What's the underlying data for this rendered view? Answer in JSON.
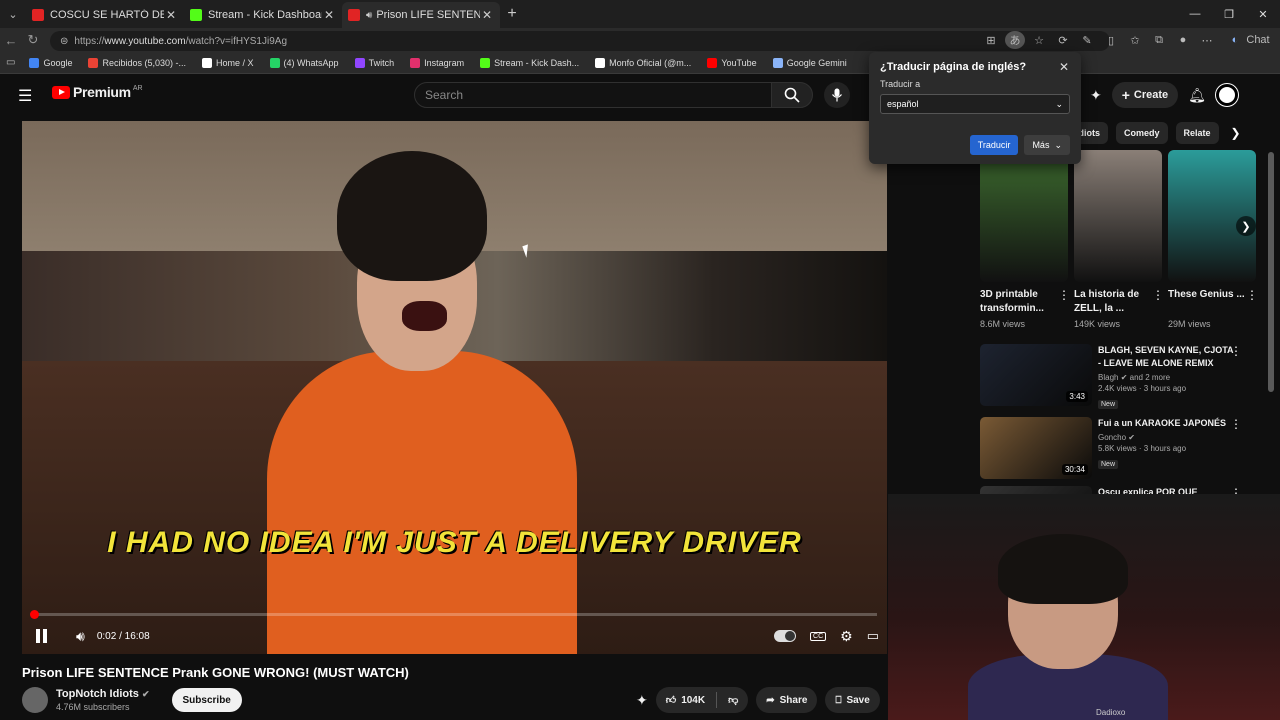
{
  "browser": {
    "tabs": [
      {
        "title": "COSCU SE HARTÓ DE BAULO Y LE",
        "color": "#e12424"
      },
      {
        "title": "Stream - Kick Dashboard",
        "color": "#53fc18"
      },
      {
        "title": "Prison LIFE SENTENCE Prank G",
        "color": "#e12424"
      }
    ],
    "url_prefix": "https://",
    "url_host": "www.youtube.com",
    "url_path": "/watch?v=ifHYS1Ji9Ag",
    "chat_label": "Chat",
    "bookmarks": [
      {
        "label": "Google",
        "color": "#4285f4"
      },
      {
        "label": "Recibidos (5,030) -...",
        "color": "#ea4335"
      },
      {
        "label": "Home / X",
        "color": "#ffffff"
      },
      {
        "label": "(4) WhatsApp",
        "color": "#25d366"
      },
      {
        "label": "Twitch",
        "color": "#9146ff"
      },
      {
        "label": "Instagram",
        "color": "#e1306c"
      },
      {
        "label": "Stream - Kick Dash...",
        "color": "#53fc18"
      },
      {
        "label": "Monfo Oficial (@m...",
        "color": "#ffffff"
      },
      {
        "label": "YouTube",
        "color": "#ff0000"
      },
      {
        "label": "Google Gemini",
        "color": "#8ab4f8"
      }
    ]
  },
  "translate_popup": {
    "title": "¿Traducir página de inglés?",
    "label": "Traducir a",
    "selected_language": "español",
    "translate_button": "Traducir",
    "more_button": "Más"
  },
  "youtube": {
    "brand": "Premium",
    "country": "AR",
    "search_placeholder": "Search",
    "create_label": "Create",
    "video": {
      "subtitle": "I HAD NO IDEA I'M JUST A DELIVERY DRIVER",
      "time": "0:02 / 16:08",
      "progress": 0.002,
      "title": "Prison LIFE SENTENCE Prank GONE WRONG! (MUST WATCH)",
      "channel": "TopNotch Idiots",
      "subscribers": "4.76M subscribers",
      "subscribe_label": "Subscribe",
      "likes": "104K",
      "share_label": "Share",
      "save_label": "Save"
    },
    "chips": [
      "n Idiots",
      "Comedy",
      "Relate"
    ],
    "shorts": [
      {
        "title": "3D printable transformin...",
        "views": "8.6M views",
        "color": "#3d6b2f"
      },
      {
        "title": "La historia de ZELL, la ...",
        "views": "149K views",
        "color": "#8a7f77"
      },
      {
        "title": "These Genius ...",
        "views": "29M views",
        "color": "#2b9c9a"
      }
    ],
    "recommendations": [
      {
        "title": "BLAGH, SEVEN KAYNE, CJOTA - LEAVE ME ALONE REMIX",
        "channel": "Blagh",
        "channel_extra": "and 2 more",
        "meta": "2.4K views · 3 hours ago",
        "badge": "New",
        "duration": "3:43",
        "color": "#1d2330"
      },
      {
        "title": "Fui a un KARAOKE JAPONÉS",
        "channel": "Goncho",
        "channel_extra": "",
        "meta": "5.8K views · 3 hours ago",
        "badge": "New",
        "duration": "30:34",
        "color": "#7a5a35"
      },
      {
        "title": "Oscu explica POR QUE EMPEZO",
        "channel": "",
        "channel_extra": "",
        "meta": "",
        "badge": "",
        "duration": "",
        "color": "#333333"
      }
    ]
  },
  "webcam": {
    "label": "Dadioxo"
  }
}
